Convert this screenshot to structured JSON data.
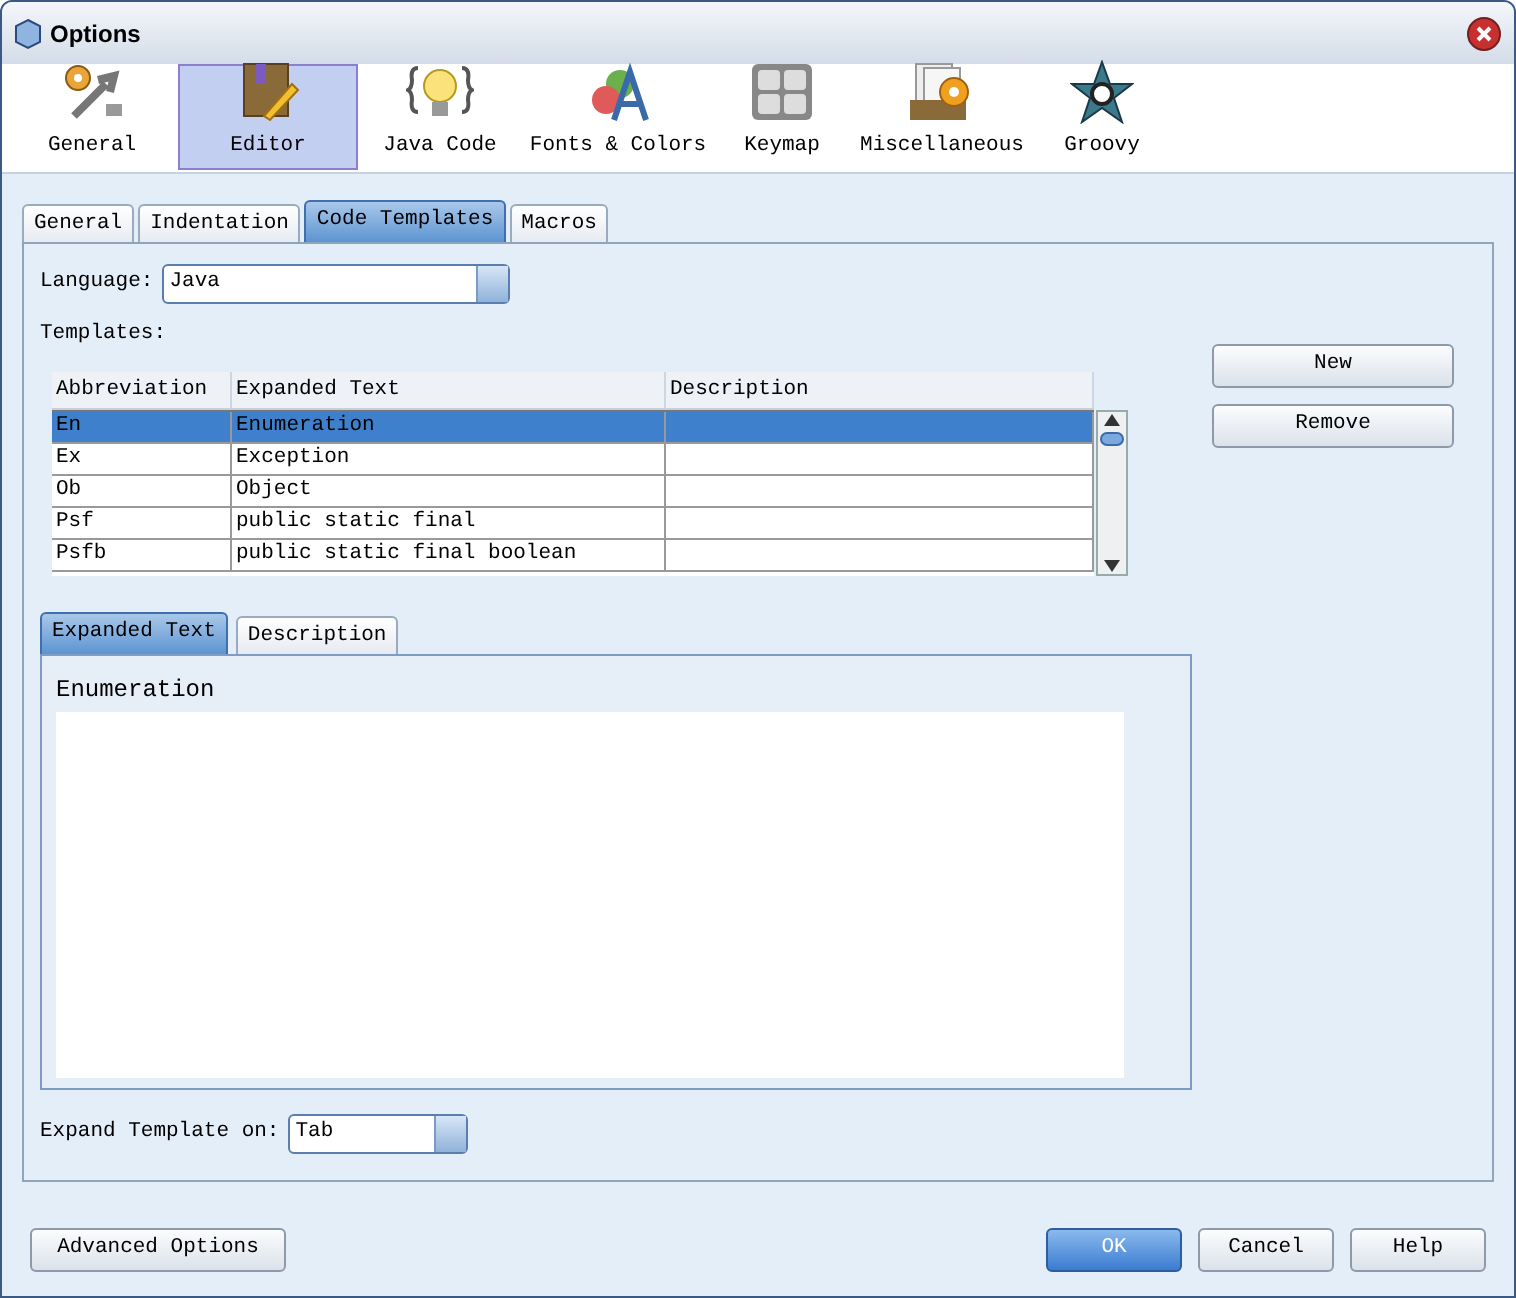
{
  "window": {
    "title": "Options"
  },
  "categories": [
    {
      "label": "General",
      "kind": "general",
      "selected": false
    },
    {
      "label": "Editor",
      "kind": "editor",
      "selected": true
    },
    {
      "label": "Java Code",
      "kind": "java",
      "selected": false
    },
    {
      "label": "Fonts & Colors",
      "kind": "fonts",
      "selected": false
    },
    {
      "label": "Keymap",
      "kind": "keymap",
      "selected": false
    },
    {
      "label": "Miscellaneous",
      "kind": "misc",
      "selected": false
    },
    {
      "label": "Groovy",
      "kind": "groovy",
      "selected": false
    }
  ],
  "tabs": [
    {
      "label": "General",
      "selected": false
    },
    {
      "label": "Indentation",
      "selected": false
    },
    {
      "label": "Code Templates",
      "selected": true
    },
    {
      "label": "Macros",
      "selected": false
    }
  ],
  "language": {
    "label": "Language:",
    "value": "Java"
  },
  "templates_label": "Templates:",
  "table": {
    "columns": [
      "Abbreviation",
      "Expanded Text",
      "Description"
    ],
    "rows": [
      {
        "cells": [
          "En",
          "Enumeration",
          ""
        ],
        "selected": true
      },
      {
        "cells": [
          "Ex",
          "Exception",
          ""
        ],
        "selected": false
      },
      {
        "cells": [
          "Ob",
          "Object",
          ""
        ],
        "selected": false
      },
      {
        "cells": [
          "Psf",
          "public static final",
          ""
        ],
        "selected": false
      },
      {
        "cells": [
          "Psfb",
          "public static final boolean",
          ""
        ],
        "selected": false
      }
    ]
  },
  "side_buttons": [
    "New",
    "Remove"
  ],
  "sub_tabs": [
    {
      "label": "Expanded Text",
      "selected": true
    },
    {
      "label": "Description",
      "selected": false
    }
  ],
  "expanded_text": "Enumeration",
  "expand_on": {
    "label": "Expand Template on:",
    "value": "Tab"
  },
  "footer": {
    "left_button": "Advanced Options",
    "buttons": [
      {
        "label": "OK",
        "primary": true
      },
      {
        "label": "Cancel",
        "primary": false
      },
      {
        "label": "Help",
        "primary": false
      }
    ]
  }
}
